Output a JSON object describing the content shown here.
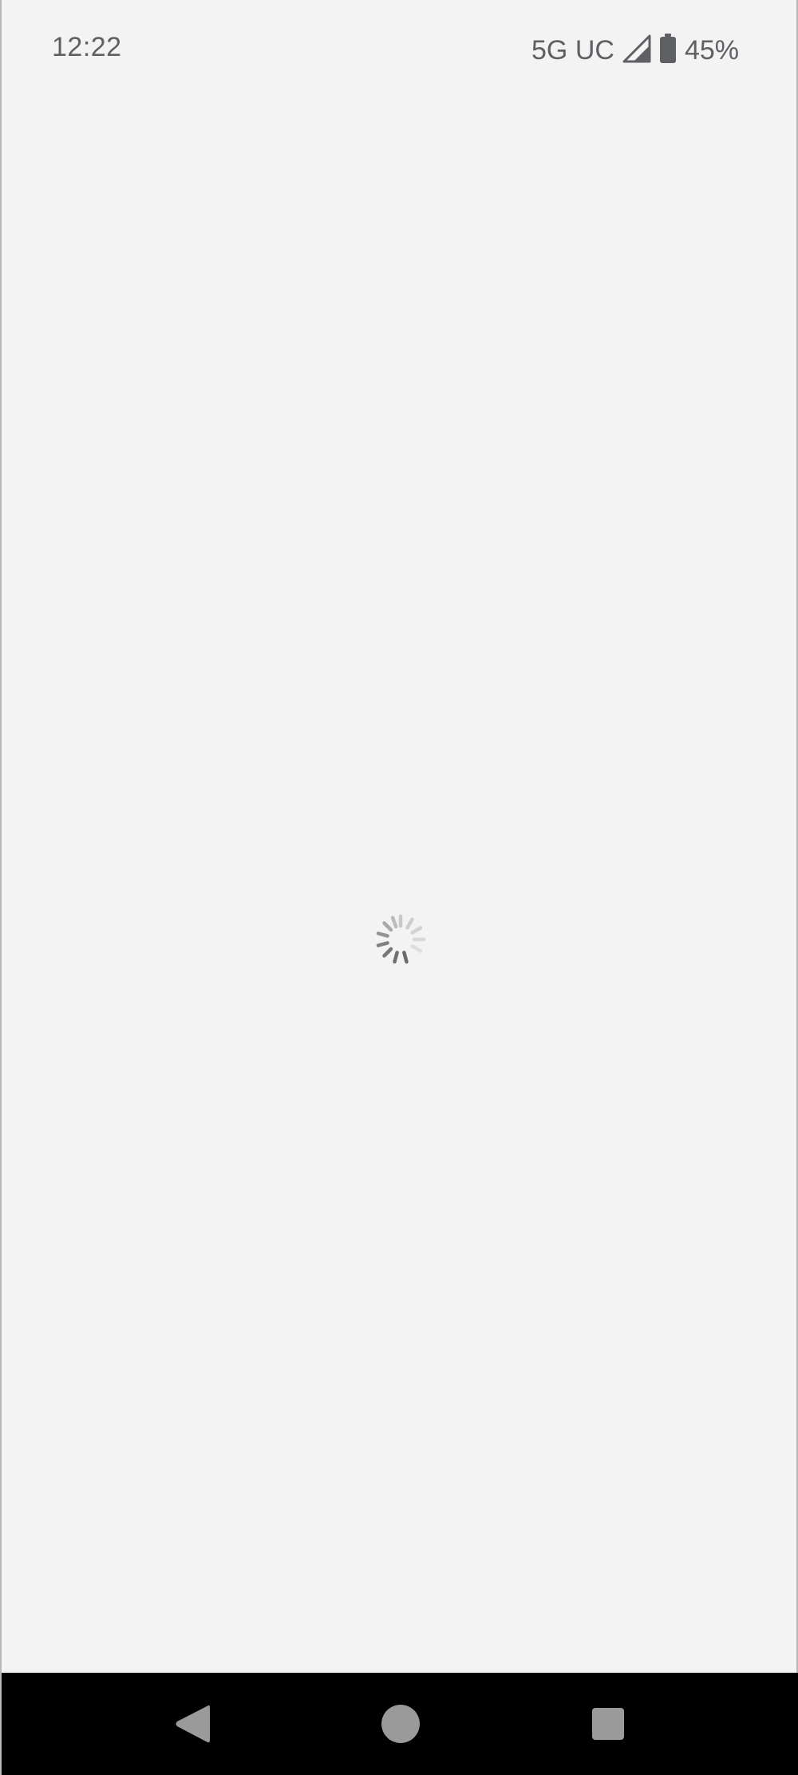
{
  "status_bar": {
    "time": "12:22",
    "network": "5G UC",
    "battery_percent": "45%",
    "signal_icon": "cellular-signal-icon",
    "battery_icon": "battery-icon"
  },
  "content": {
    "state": "loading",
    "spinner_icon": "loading-spinner-icon"
  },
  "nav_bar": {
    "back_icon": "back-triangle-icon",
    "home_icon": "home-circle-icon",
    "recents_icon": "recents-square-icon"
  },
  "colors": {
    "background": "#f3f3f3",
    "status_text": "#5f6064",
    "nav_bar": "#000000",
    "nav_button": "#9a9a9a"
  }
}
